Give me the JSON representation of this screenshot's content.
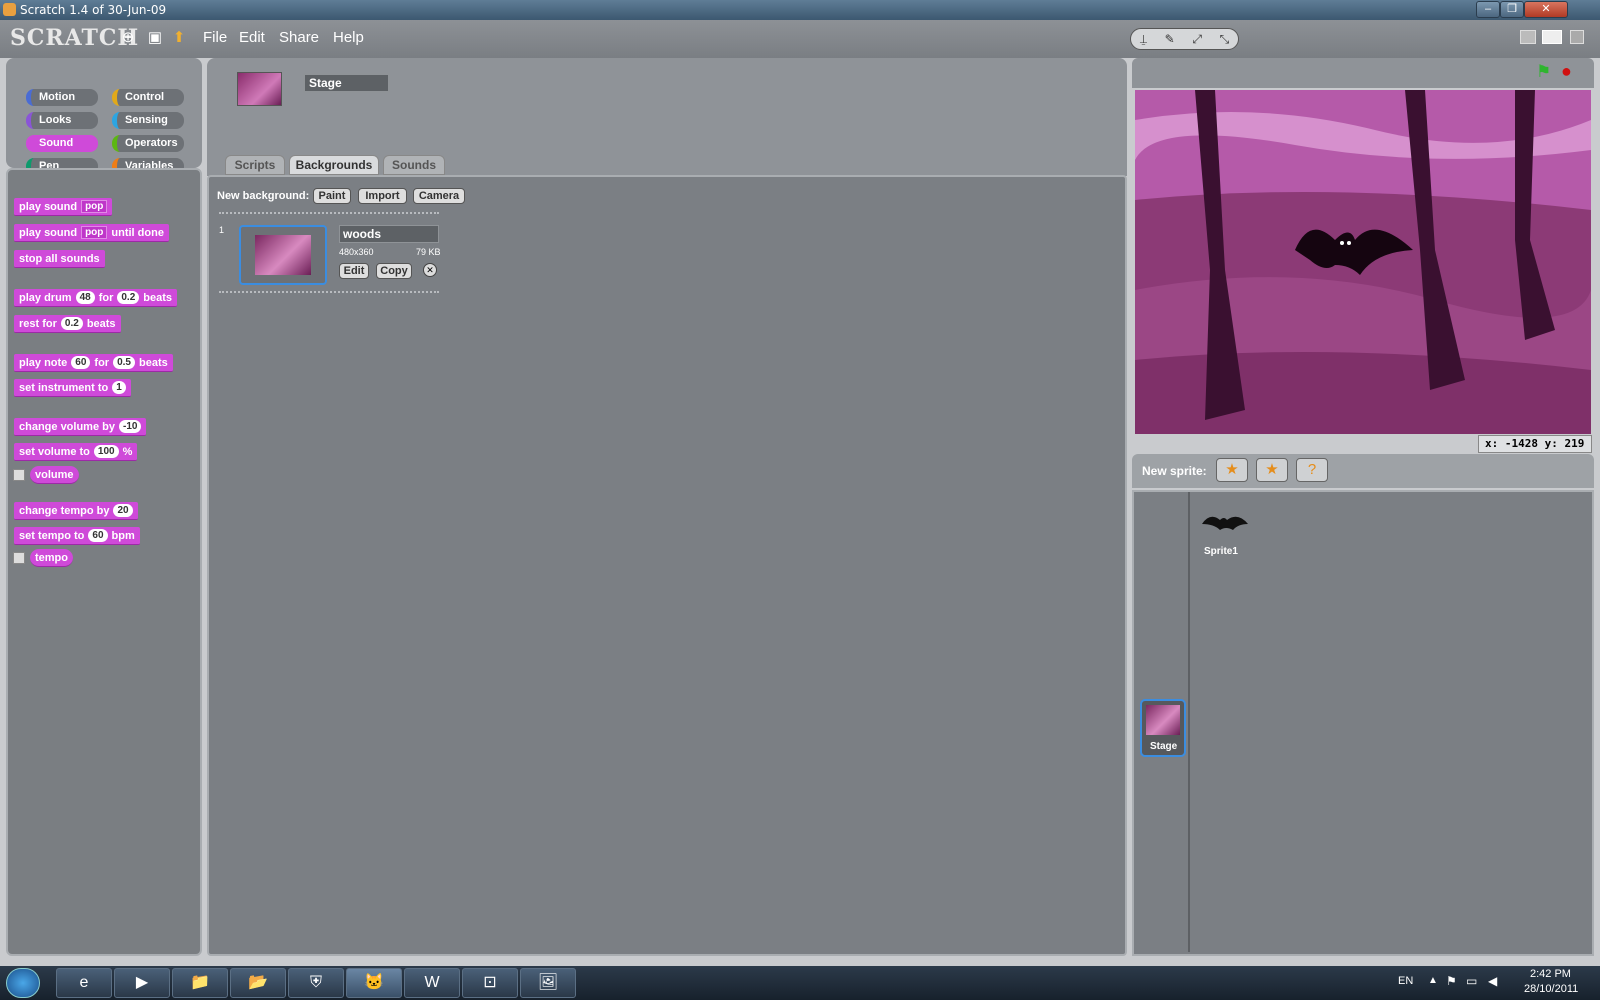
{
  "window": {
    "title": "Scratch 1.4 of 30-Jun-09",
    "controls": [
      "–",
      "❐",
      "✕"
    ]
  },
  "menubar": {
    "logo": "SCRATCH",
    "menus": [
      "File",
      "Edit",
      "Share",
      "Help"
    ],
    "mode_icons": [
      "⍊",
      "✎",
      "⤢",
      "⤡"
    ]
  },
  "categories": [
    {
      "label": "Motion",
      "color": "#4a6cd4"
    },
    {
      "label": "Control",
      "color": "#e1a91a"
    },
    {
      "label": "Looks",
      "color": "#8a55d7"
    },
    {
      "label": "Sensing",
      "color": "#2ca5e2"
    },
    {
      "label": "Sound",
      "color": "#cf4ad9"
    },
    {
      "label": "Operators",
      "color": "#5cb712"
    },
    {
      "label": "Pen",
      "color": "#0e9a6c"
    },
    {
      "label": "Variables",
      "color": "#ee7d16"
    }
  ],
  "blocks": {
    "play_sound": {
      "text": "play sound",
      "dd": "pop"
    },
    "play_sound_until": {
      "text": "play sound",
      "dd": "pop",
      "suffix": "until done"
    },
    "stop_all": "stop all sounds",
    "play_drum": {
      "text": "play drum",
      "drum": "48",
      "for": "for",
      "beats_val": "0.2",
      "beats": "beats"
    },
    "rest": {
      "text": "rest for",
      "val": "0.2",
      "beats": "beats"
    },
    "play_note": {
      "text": "play note",
      "note": "60",
      "for": "for",
      "beats_val": "0.5",
      "beats": "beats"
    },
    "set_instrument": {
      "text": "set instrument to",
      "val": "1"
    },
    "change_volume": {
      "text": "change volume by",
      "val": "-10"
    },
    "set_volume": {
      "text": "set volume to",
      "val": "100",
      "pct": "%"
    },
    "volume": "volume",
    "change_tempo": {
      "text": "change tempo by",
      "val": "20"
    },
    "set_tempo": {
      "text": "set tempo to",
      "val": "60",
      "bpm": "bpm"
    },
    "tempo": "tempo"
  },
  "center": {
    "object_name": "Stage",
    "tabs": [
      "Scripts",
      "Backgrounds",
      "Sounds"
    ],
    "new_background_label": "New background:",
    "bg_buttons": [
      "Paint",
      "Import",
      "Camera"
    ],
    "costume": {
      "index": "1",
      "name": "woods",
      "size": "480x360",
      "kb": "79 KB",
      "edit": "Edit",
      "copy": "Copy",
      "delete": "✕"
    }
  },
  "stage": {
    "xy": "x: -1428  y: 219",
    "flag": "⚑",
    "stop": "●"
  },
  "sprites": {
    "new_label": "New sprite:",
    "btns": [
      "★",
      "★",
      "?"
    ],
    "sprite1": "Sprite1",
    "stage_label": "Stage"
  },
  "taskbar": {
    "lang": "EN",
    "time": "2:42 PM",
    "date": "28/10/2011",
    "apps": [
      "e",
      "▶",
      "📁",
      "📂",
      "⛨",
      "🐱",
      "W",
      "⊡",
      "🖼"
    ]
  }
}
